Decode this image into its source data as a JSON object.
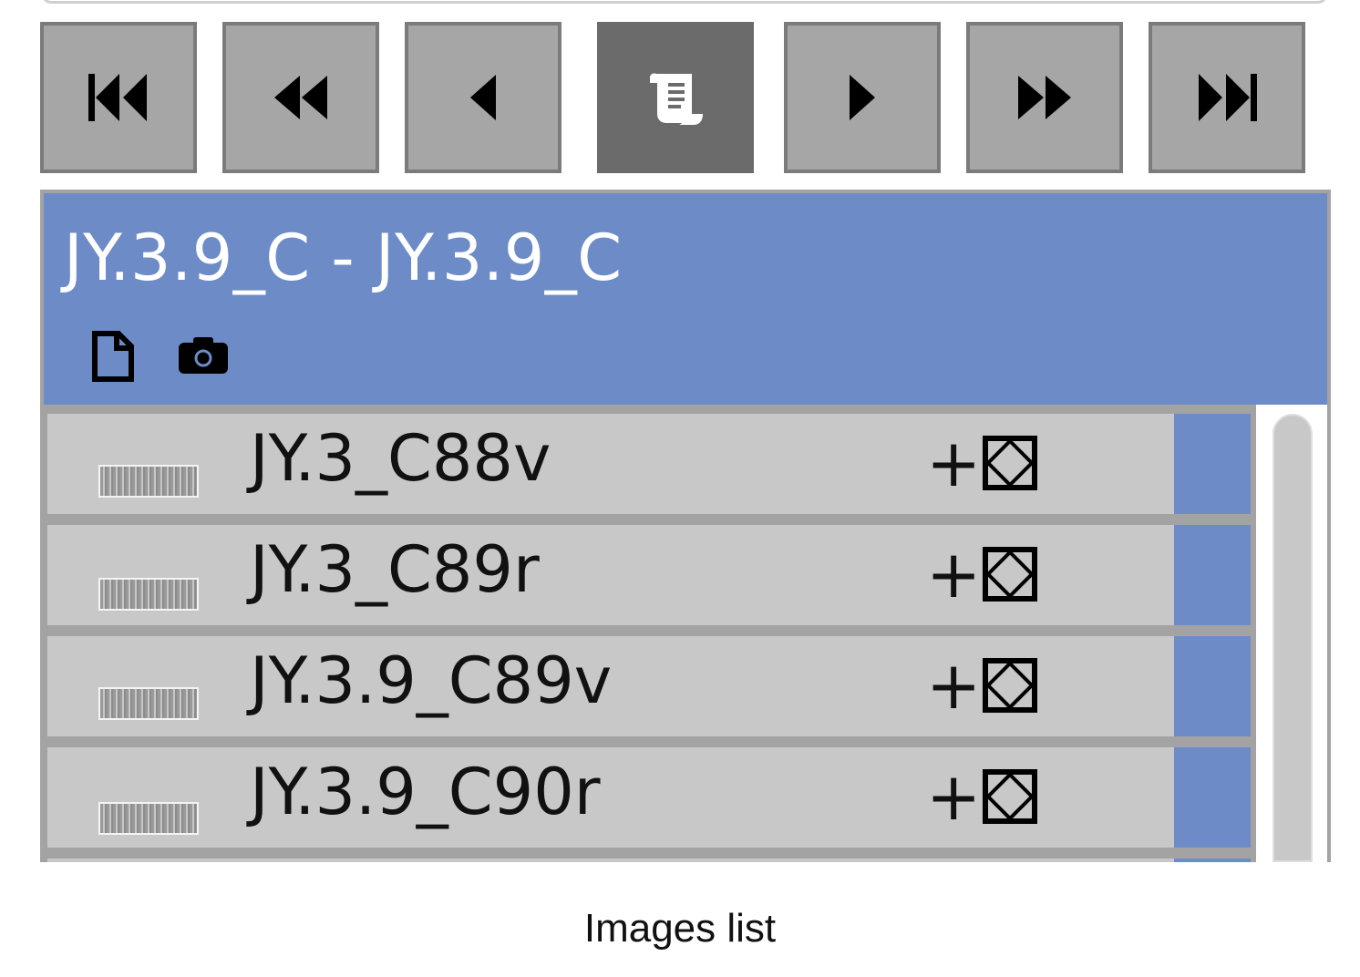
{
  "toolbar": {
    "buttons": [
      {
        "name": "first",
        "icon": "first-page-icon"
      },
      {
        "name": "fast-back",
        "icon": "fast-back-icon"
      },
      {
        "name": "prev",
        "icon": "prev-icon"
      },
      {
        "name": "scroll",
        "icon": "scroll-icon",
        "active": true
      },
      {
        "name": "next",
        "icon": "next-icon"
      },
      {
        "name": "fast-forward",
        "icon": "fast-forward-icon"
      },
      {
        "name": "last",
        "icon": "last-page-icon"
      }
    ]
  },
  "panel": {
    "title": "JY.3.9_C - JY.3.9_C",
    "icons": [
      "document-icon",
      "camera-icon"
    ]
  },
  "images": [
    {
      "label": "JY.3_C88v",
      "add": "+"
    },
    {
      "label": "JY.3_C89r",
      "add": "+"
    },
    {
      "label": "JY.3.9_C89v",
      "add": "+"
    },
    {
      "label": "JY.3.9_C90r",
      "add": "+"
    }
  ],
  "caption": "Images list",
  "colors": {
    "header_blue": "#6d8cc7",
    "button_gray": "#a6a6a6",
    "button_active": "#6b6b6b",
    "row_gray": "#c8c8c8"
  }
}
